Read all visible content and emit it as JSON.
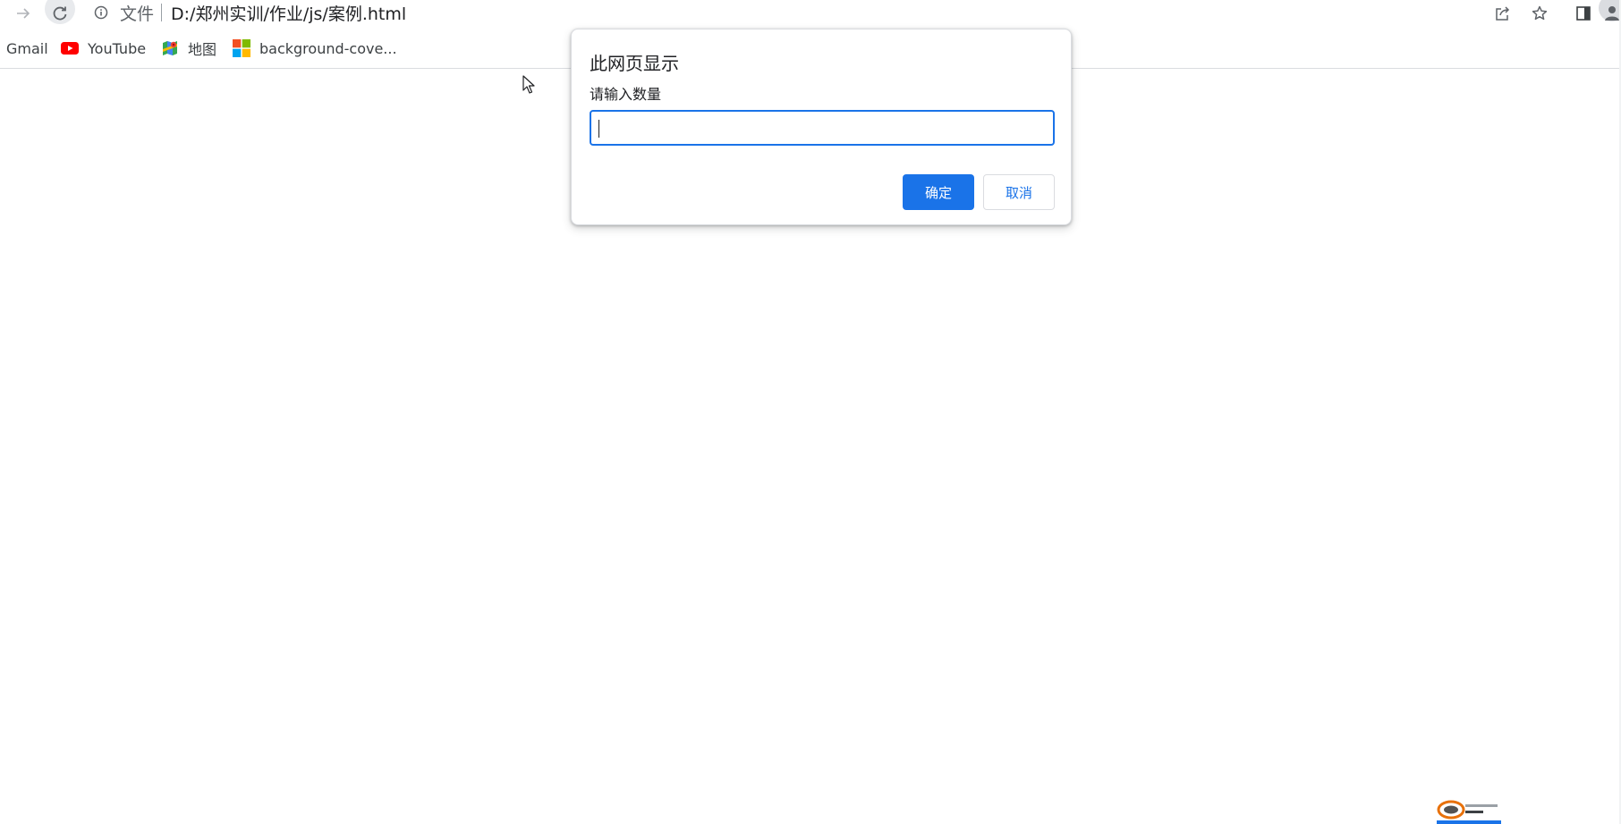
{
  "toolbar": {
    "scheme_label": "文件",
    "url": "D:/郑州实训/作业/js/案例.html",
    "icons": [
      "forward-icon",
      "reload-icon",
      "info-icon",
      "share-icon",
      "star-icon",
      "sidepanel-icon",
      "profile-icon"
    ]
  },
  "bookmarks": {
    "items": [
      {
        "label": "Gmail",
        "icon": "none"
      },
      {
        "label": "YouTube",
        "icon": "youtube-icon"
      },
      {
        "label": "地图",
        "icon": "maps-icon"
      },
      {
        "label": "background-cove...",
        "icon": "microsoft-icon"
      }
    ]
  },
  "dialog": {
    "title": "此网页显示",
    "message": "请输入数量",
    "input_value": "",
    "ok_label": "确定",
    "cancel_label": "取消"
  },
  "colors": {
    "accent": "#1a73e8",
    "youtube_red": "#ff0000",
    "text": "#202124",
    "muted": "#5f6368"
  }
}
